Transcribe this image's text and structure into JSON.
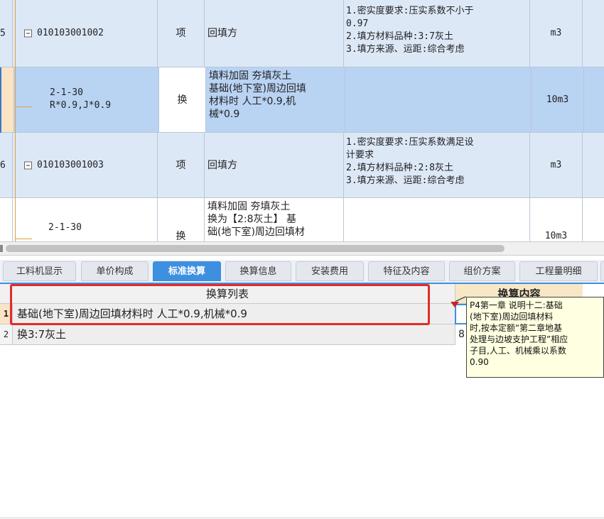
{
  "grid": {
    "rows": [
      {
        "idx": "5",
        "code": "010103001002",
        "unit1": "项",
        "name": "回填方",
        "features": [
          "1.密实度要求:压实系数不小于",
          "0.97",
          "2.填方材料品种:3:7灰土",
          "3.填方来源、运距:综合考虑"
        ],
        "unit": "m3"
      },
      {
        "idx": "",
        "code": "2-1-30",
        "code2": "R*0.9,J*0.9",
        "unit1": "换",
        "name": [
          "填料加固 夯填灰土",
          "基础(地下室)周边回填",
          "材料时 人工*0.9,机",
          "械*0.9"
        ],
        "features": [],
        "unit": "10m3"
      },
      {
        "idx": "6",
        "code": "010103001003",
        "unit1": "项",
        "name": "回填方",
        "features": [
          "1.密实度要求:压实系数满足设",
          "计要求",
          "2.填方材料品种:2:8灰土",
          "3.填方来源、运距:综合考虑"
        ],
        "unit": "m3"
      },
      {
        "idx": "",
        "code": "2-1-30",
        "unit1": "换",
        "name": [
          "填料加固 夯填灰土",
          "换为【2:8灰土】 基",
          "础(地下室)周边回填材"
        ],
        "features": [],
        "unit": "10m3"
      }
    ]
  },
  "tabs": [
    {
      "label": "工料机显示",
      "active": false
    },
    {
      "label": "单价构成",
      "active": false
    },
    {
      "label": "标准换算",
      "active": true
    },
    {
      "label": "换算信息",
      "active": false
    },
    {
      "label": "安装费用",
      "active": false
    },
    {
      "label": "特征及内容",
      "active": false
    },
    {
      "label": "组价方案",
      "active": false
    },
    {
      "label": "工程量明细",
      "active": false
    }
  ],
  "conversion": {
    "header_list": "换算列表",
    "header_content": "换算内容",
    "rows": [
      {
        "num": "1",
        "text": "基础(地下室)周边回填材料时 人工*0.9,机械*0.9"
      },
      {
        "num": "2",
        "text": "换3:7灰土",
        "content": "8"
      }
    ]
  },
  "tooltip": {
    "lines": [
      "P4第一章 说明十二:基础",
      "(地下室)周边回填材料",
      "时,按本定额“第二章地基",
      "处理与边坡支护工程”相应",
      "子目,人工、机械乘以系数",
      "0.90"
    ]
  },
  "colors": {
    "accent": "#3d8fe0",
    "highlight": "#e22b2b",
    "selected_row": "#b9d3f3"
  }
}
